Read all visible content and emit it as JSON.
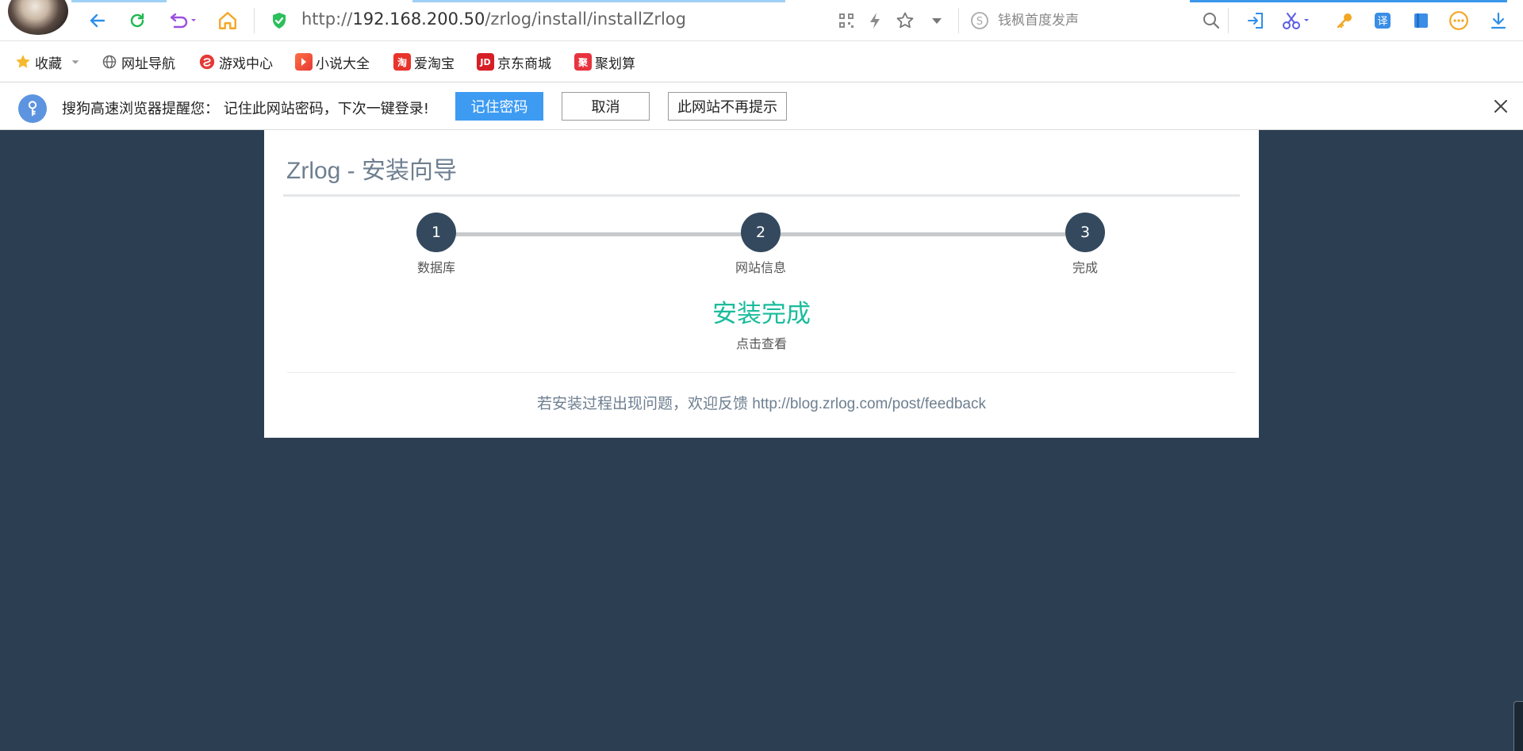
{
  "browser": {
    "url_prefix": "http://",
    "url_host": "192.168.200.50",
    "url_path": "/zrlog/install/installZrlog",
    "search_placeholder": "钱枫首度发声",
    "accent_color": "#2f8fe8"
  },
  "bookmarks": {
    "items": [
      {
        "label": "收藏",
        "icon": "star-icon"
      },
      {
        "label": "网址导航",
        "icon": "globe-icon"
      },
      {
        "label": "游戏中心",
        "icon": "game-icon"
      },
      {
        "label": "小说大全",
        "icon": "novel-icon"
      },
      {
        "label": "爱淘宝",
        "icon": "taobao-icon",
        "glyph": "淘"
      },
      {
        "label": "京东商城",
        "icon": "jd-icon",
        "glyph": "JD"
      },
      {
        "label": "聚划算",
        "icon": "juhuasuan-icon",
        "glyph": "聚"
      }
    ]
  },
  "notification": {
    "message": "搜狗高速浏览器提醒您：  记住此网站密码，下次一键登录!",
    "remember_label": "记住密码",
    "cancel_label": "取消",
    "never_label": "此网站不再提示"
  },
  "page": {
    "title": "Zrlog - 安装向导",
    "steps": [
      {
        "number": "1",
        "label": "数据库"
      },
      {
        "number": "2",
        "label": "网站信息"
      },
      {
        "number": "3",
        "label": "完成"
      }
    ],
    "done_title": "安装完成",
    "done_link": "点击查看",
    "feedback_text": "若安装过程出现问题，欢迎反馈 ",
    "feedback_url": "http://blog.zrlog.com/post/feedback",
    "success_color": "#1abc9c",
    "step_color": "#34495e",
    "background_color": "#2c3e52"
  }
}
